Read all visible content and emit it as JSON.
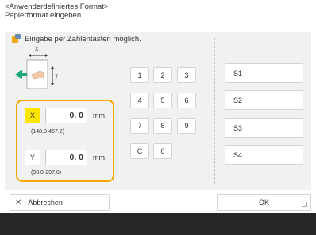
{
  "header": {
    "line1": "<Anwenderdefiniertes Format>",
    "line2": "Papierformat eingeben."
  },
  "hint": {
    "text": "Eingabe per Zahlentasten möglich."
  },
  "diagram": {
    "x_label": "X",
    "y_label": "Y"
  },
  "keypad": {
    "keys": [
      "1",
      "2",
      "3",
      "4",
      "5",
      "6",
      "7",
      "8",
      "9",
      "C",
      "0"
    ]
  },
  "x_field": {
    "label": "X",
    "value": "0. 0",
    "unit": "mm",
    "range": "(148.0-457.2)"
  },
  "y_field": {
    "label": "Y",
    "value": "0. 0",
    "unit": "mm",
    "range": "(98.0-297.0)"
  },
  "presets": {
    "items": [
      "S1",
      "S2",
      "S3",
      "S4"
    ]
  },
  "footer": {
    "cancel_label": "Abbrechen",
    "ok_label": "OK"
  },
  "colors": {
    "accent_orange": "#f5a800",
    "selected_yellow": "#ffe600",
    "bottom_bar": "#262626",
    "panel_bg": "#f1f1f1"
  }
}
